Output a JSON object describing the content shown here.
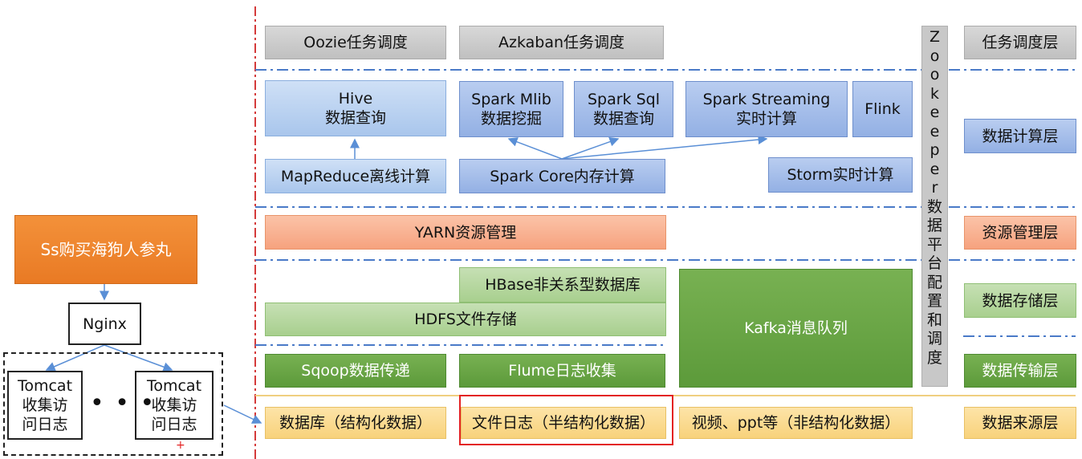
{
  "layers": {
    "scheduling": "任务调度层",
    "compute": "数据计算层",
    "resource": "资源管理层",
    "storage": "数据存储层",
    "transport": "数据传输层",
    "source": "数据来源层"
  },
  "scheduling": {
    "oozie": "Oozie任务调度",
    "azkaban": "Azkaban任务调度"
  },
  "compute": {
    "hive_line1": "Hive",
    "hive_line2": "数据查询",
    "mllib_line1": "Spark Mlib",
    "mllib_line2": "数据挖掘",
    "sql_line1": "Spark Sql",
    "sql_line2": "数据查询",
    "streaming_line1": "Spark Streaming",
    "streaming_line2": "实时计算",
    "flink": "Flink",
    "mapreduce": "MapReduce离线计算",
    "spark_core": "Spark Core内存计算",
    "storm": "Storm实时计算"
  },
  "resource": {
    "yarn": "YARN资源管理"
  },
  "storage": {
    "hbase": "HBase非关系型数据库",
    "hdfs": "HDFS文件存储",
    "kafka": "Kafka消息队列"
  },
  "transport": {
    "sqoop": "Sqoop数据传递",
    "flume": "Flume日志收集"
  },
  "source": {
    "database": "数据库（结构化数据）",
    "file_log": "文件日志（半结构化数据）",
    "video": "视频、ppt等（非结构化数据）"
  },
  "zookeeper": [
    "Z",
    "o",
    "o",
    "k",
    "e",
    "e",
    "p",
    "e",
    "r",
    "数",
    "据",
    "平",
    "台",
    "配",
    "置",
    "和",
    "调",
    "度"
  ],
  "left": {
    "shop": "Ss购买海狗人参丸",
    "nginx": "Nginx",
    "tomcat1_line1": "Tomcat",
    "tomcat1_line2": "收集访",
    "tomcat1_line3": "问日志",
    "tomcat2_line1": "Tomcat",
    "tomcat2_line2": "收集访",
    "tomcat2_line3": "问日志",
    "dots": "• • •",
    "plus": "+"
  },
  "colors": {
    "blue_dash": "#4a7ac8",
    "red": "#e32222",
    "orange_fill": "#f6a27e",
    "green_fill": "#5c9a3a",
    "yellow_fill": "#f8d27b",
    "gray_fill": "#c8c8c8"
  }
}
